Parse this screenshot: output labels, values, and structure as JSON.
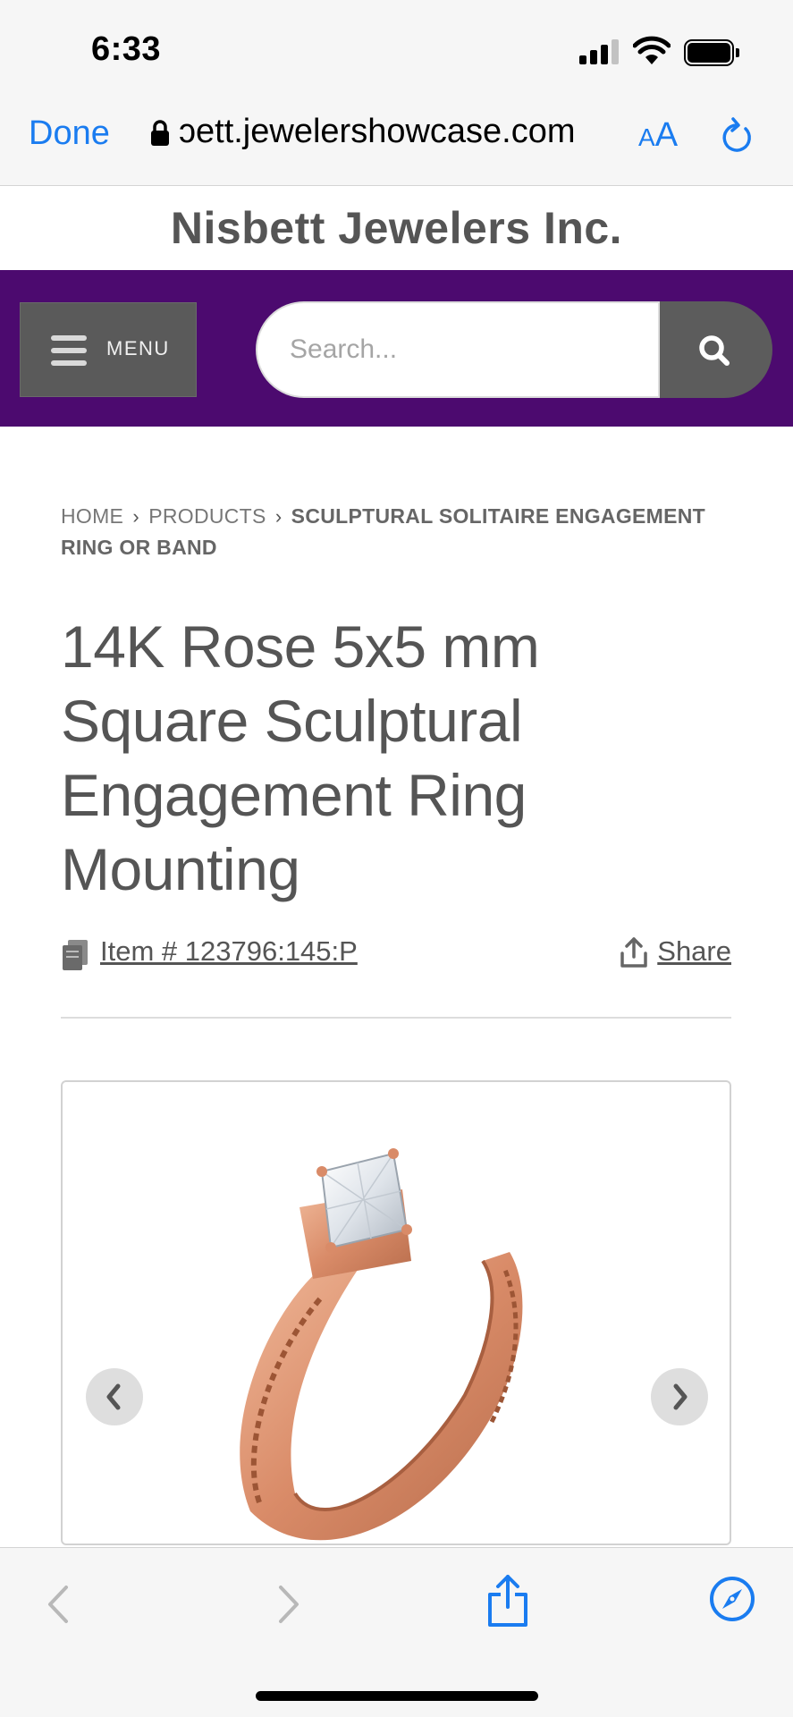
{
  "status_bar": {
    "time": "6:33"
  },
  "browser": {
    "done_label": "Done",
    "url": "ɔett.jewelershowcase.com",
    "text_size_small": "A",
    "text_size_large": "A",
    "accent_color": "#1a7cf0"
  },
  "site": {
    "title": "Nisbett Jewelers Inc.",
    "nav_color": "#4c0a6f",
    "menu_label": "MENU",
    "search_placeholder": "Search..."
  },
  "breadcrumb": {
    "home": "HOME",
    "products": "PRODUCTS",
    "current": "SCULPTURAL SOLITAIRE ENGAGEMENT RING OR BAND"
  },
  "product": {
    "title": "14K Rose 5x5 mm Square Sculptural Engagement Ring Mounting",
    "item_number": "Item # 123796:145:P",
    "share_label": "Share",
    "image_alt": "rose gold square solitaire engagement ring"
  },
  "icons": {
    "search": "search-icon",
    "menu": "hamburger-icon",
    "document": "document-icon",
    "share": "share-icon",
    "prev": "chevron-left-icon",
    "next": "chevron-right-icon",
    "reload": "reload-icon",
    "lock": "lock-icon",
    "compass": "compass-icon"
  }
}
